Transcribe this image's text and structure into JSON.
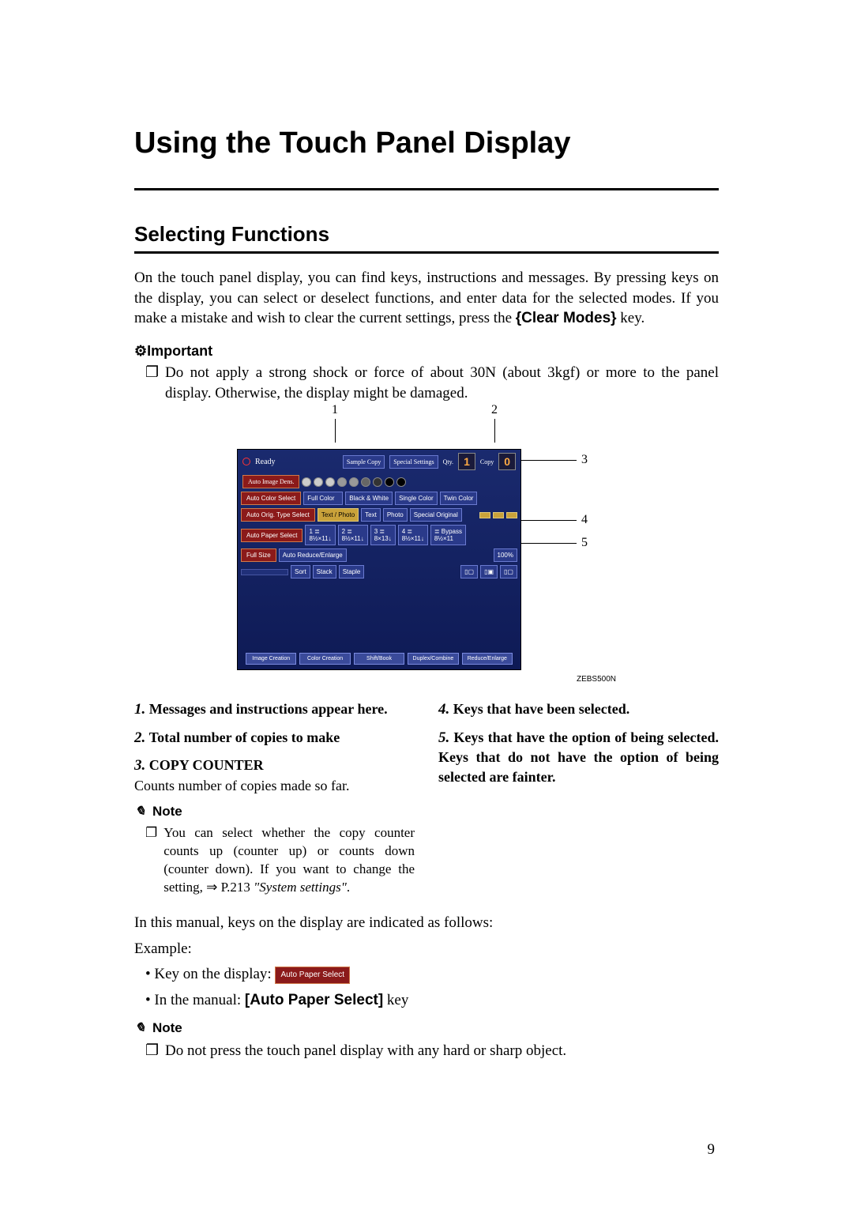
{
  "title": "Using the Touch Panel Display",
  "section": "Selecting Functions",
  "intro_a": "On the touch panel display, you can find keys, instructions and messages. By pressing keys on the display, you can select or deselect functions, and enter data for the selected modes. If you make a mistake and wish to clear the current settings, press the ",
  "clear_modes_key": "{Clear Modes}",
  "intro_b": " key.",
  "important_label": "Important",
  "important_bullet": "Do not apply a strong shock or force of about 30N (about 3kgf) or more to the panel display. Otherwise, the display might be damaged.",
  "figure": {
    "callouts": {
      "c1": "1",
      "c2": "2",
      "c3": "3",
      "c4": "4",
      "c5": "5"
    },
    "code": "ZEBS500N",
    "panel": {
      "ready": "Ready",
      "qty": "Qty.",
      "qty_val": "1",
      "copy": "Copy",
      "copy_val": "0",
      "sample_copy": "Sample Copy",
      "special_settings": "Special Settings",
      "auto_image_dens": "Auto Image Dens.",
      "auto_color_select": "Auto Color Select",
      "full_color": "Full Color",
      "bw": "Black & White",
      "single_color": "Single Color",
      "twin_color": "Twin Color",
      "auto_orig_type": "Auto Orig. Type Select",
      "text_photo": "Text / Photo",
      "text": "Text",
      "photo": "Photo",
      "special_original": "Special Original",
      "auto_paper_select": "Auto Paper Select",
      "tray1": "1 ≣\n8½×11↓",
      "tray2": "2 ≣\n8½×11↓",
      "tray3": "3 ≣\n8×13↓",
      "tray4": "4 ≣\n8½×11↓",
      "bypass": "≣ Bypass\n8½×11",
      "full_size": "Full Size",
      "auto_re": "Auto Reduce/Enlarge",
      "pct": "100%",
      "sort_btn": "Sort",
      "stack_btn": "Stack",
      "staple_btn": "Staple",
      "tab_image": "Image Creation",
      "tab_color": "Color Creation",
      "tab_shift": "Shift/Book",
      "tab_duplex": "Duplex/Combine",
      "tab_reduce": "Reduce/Enlarge"
    }
  },
  "legend": {
    "n1": "1.",
    "t1": "Messages and instructions appear here.",
    "n2": "2.",
    "t2": "Total number of copies to make",
    "n3": "3.",
    "t3": "COPY COUNTER",
    "t3_sub": "Counts number of copies made so far.",
    "n4": "4.",
    "t4": "Keys that have been selected.",
    "n5": "5.",
    "t5": "Keys that have the option of being selected. Keys that do not have the option of being selected are fainter."
  },
  "note_label": "Note",
  "note1": "You can select whether the copy counter counts up (counter up) or counts down (counter down). If you want to change the setting, ⇒ P.213 ",
  "note1_italic": "\"System settings\"",
  "note1_end": ".",
  "manual_line": "In this manual, keys on the display are indicated as follows:",
  "example_label": "Example:",
  "key_on_display": "Key on the display: ",
  "auto_paper_chip": "Auto Paper Select",
  "in_the_manual": "In the manual: ",
  "in_the_manual_key": "[Auto Paper Select]",
  "in_the_manual_end": " key",
  "note2": "Do not press the touch panel display with any hard or sharp object.",
  "page_num": "9",
  "bullet_sym": "❐"
}
